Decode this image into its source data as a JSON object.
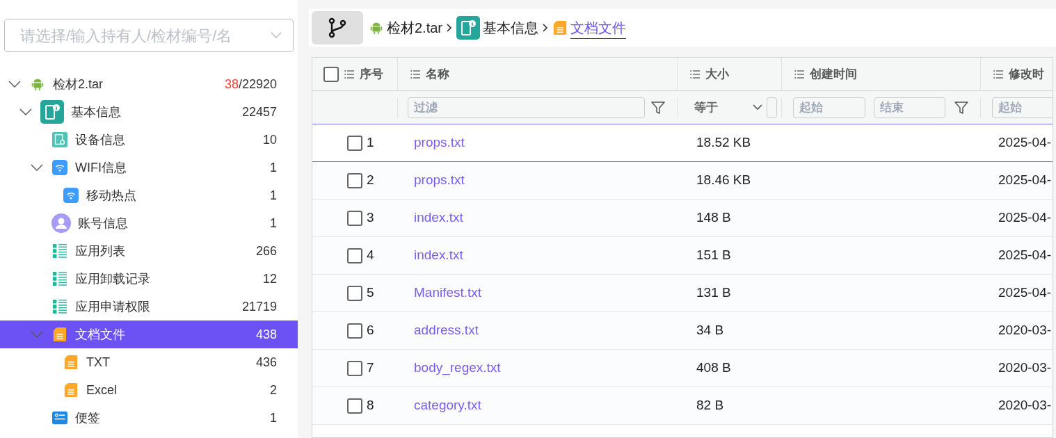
{
  "sidebar": {
    "selector": {
      "placeholder": "请选择/输入持有人/检材编号/名"
    },
    "tree": [
      {
        "label": "检材2.tar",
        "kind": "android",
        "flagged": "38",
        "count": "/22920",
        "selected": false,
        "expanded": true,
        "children": [
          {
            "label": "基本信息",
            "kind": "info-phone",
            "count": "22457",
            "selected": false,
            "expanded": true,
            "children": [
              {
                "label": "设备信息",
                "kind": "device",
                "count": "10",
                "selected": false
              },
              {
                "label": "WIFI信息",
                "kind": "wifi",
                "count": "1",
                "selected": false,
                "expanded": true,
                "children": [
                  {
                    "label": "移动热点",
                    "kind": "wifi",
                    "count": "1",
                    "selected": false
                  }
                ]
              },
              {
                "label": "账号信息",
                "kind": "account",
                "count": "1",
                "selected": false
              },
              {
                "label": "应用列表",
                "kind": "list",
                "count": "266",
                "selected": false
              },
              {
                "label": "应用卸载记录",
                "kind": "list",
                "count": "12",
                "selected": false
              },
              {
                "label": "应用申请权限",
                "kind": "list",
                "count": "21719",
                "selected": false
              },
              {
                "label": "文档文件",
                "kind": "doc",
                "count": "438",
                "selected": true,
                "expanded": true,
                "children": [
                  {
                    "label": "TXT",
                    "kind": "doc",
                    "count": "436",
                    "selected": false
                  },
                  {
                    "label": "Excel",
                    "kind": "doc",
                    "count": "2",
                    "selected": false
                  }
                ]
              },
              {
                "label": "便签",
                "kind": "note",
                "count": "1",
                "selected": false
              }
            ]
          }
        ]
      }
    ]
  },
  "breadcrumb": [
    {
      "label": "检材2.tar",
      "kind": "android",
      "current": false
    },
    {
      "label": "基本信息",
      "kind": "info-phone",
      "current": false
    },
    {
      "label": "文档文件",
      "kind": "doc",
      "current": true
    }
  ],
  "table": {
    "columns": [
      {
        "label": "序号"
      },
      {
        "label": "名称"
      },
      {
        "label": "大小"
      },
      {
        "label": "创建时间"
      },
      {
        "label": "修改时"
      }
    ],
    "select_all_checked": false,
    "filters": {
      "name": {
        "placeholder": "过滤"
      },
      "size": {
        "operator": "等于"
      },
      "created": {
        "start_placeholder": "起始",
        "end_placeholder": "结束"
      },
      "modified": {
        "start_placeholder": "起始"
      }
    },
    "rows": [
      {
        "index": "1",
        "name": "props.txt",
        "size": "18.52 KB",
        "modified": "2025-04-",
        "checked": false,
        "focused": true
      },
      {
        "index": "2",
        "name": "props.txt",
        "size": "18.46 KB",
        "modified": "2025-04-",
        "checked": false,
        "focused": false
      },
      {
        "index": "3",
        "name": "index.txt",
        "size": "148 B",
        "modified": "2025-04-",
        "checked": false,
        "focused": false
      },
      {
        "index": "4",
        "name": "index.txt",
        "size": "151 B",
        "modified": "2025-04-",
        "checked": false,
        "focused": false
      },
      {
        "index": "5",
        "name": "Manifest.txt",
        "size": "131 B",
        "modified": "2025-04-",
        "checked": false,
        "focused": false
      },
      {
        "index": "6",
        "name": "address.txt",
        "size": "34 B",
        "modified": "2020-03-",
        "checked": false,
        "focused": false
      },
      {
        "index": "7",
        "name": "body_regex.txt",
        "size": "408 B",
        "modified": "2020-03-",
        "checked": false,
        "focused": false
      },
      {
        "index": "8",
        "name": "category.txt",
        "size": "82 B",
        "modified": "2020-03-",
        "checked": false,
        "focused": false
      }
    ]
  }
}
